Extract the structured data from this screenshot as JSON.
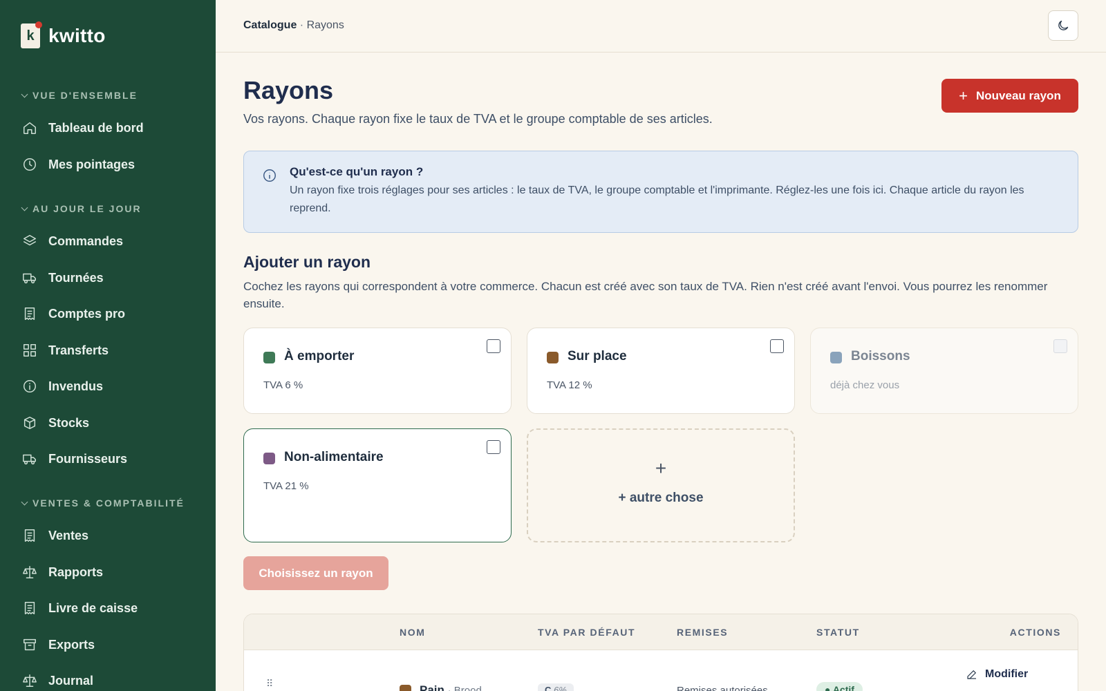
{
  "brand": {
    "name": "kwitto",
    "mark": "k"
  },
  "sidebar": {
    "sections": [
      {
        "label": "VUE D'ENSEMBLE"
      },
      {
        "label": "AU JOUR LE JOUR"
      },
      {
        "label": "VENTES & COMPTABILITÉ"
      }
    ],
    "items": [
      {
        "label": "Tableau de bord",
        "icon": "home-icon"
      },
      {
        "label": "Mes pointages",
        "icon": "clock-icon"
      },
      {
        "label": "Commandes",
        "icon": "layers-icon"
      },
      {
        "label": "Tournées",
        "icon": "truck-icon"
      },
      {
        "label": "Comptes pro",
        "icon": "receipt-icon"
      },
      {
        "label": "Transferts",
        "icon": "grid-icon"
      },
      {
        "label": "Invendus",
        "icon": "info-circle-icon"
      },
      {
        "label": "Stocks",
        "icon": "box-icon"
      },
      {
        "label": "Fournisseurs",
        "icon": "truck-icon"
      },
      {
        "label": "Ventes",
        "icon": "receipt-icon"
      },
      {
        "label": "Rapports",
        "icon": "scale-icon"
      },
      {
        "label": "Livre de caisse",
        "icon": "receipt-icon"
      },
      {
        "label": "Exports",
        "icon": "archive-icon"
      },
      {
        "label": "Journal",
        "icon": "scale-icon"
      }
    ]
  },
  "breadcrumb": {
    "root": "Catalogue",
    "sep": "·",
    "current": "Rayons"
  },
  "page": {
    "title": "Rayons",
    "subtitle": "Vos rayons. Chaque rayon fixe le taux de TVA et le groupe comptable de ses articles.",
    "new_button": "Nouveau rayon"
  },
  "info": {
    "title": "Qu'est-ce qu'un rayon ?",
    "body": "Un rayon fixe trois réglages pour ses articles : le taux de TVA, le groupe comptable et l'imprimante. Réglez-les une fois ici. Chaque article du rayon les reprend."
  },
  "add_section": {
    "title": "Ajouter un rayon",
    "subtitle": "Cochez les rayons qui correspondent à votre commerce. Chacun est créé avec son taux de TVA. Rien n'est créé avant l'envoi. Vous pourrez les renommer ensuite.",
    "cards": [
      {
        "name": "À emporter",
        "sub": "TVA 6 %",
        "color": "#3f7a57"
      },
      {
        "name": "Sur place",
        "sub": "TVA 12 %",
        "color": "#8a5a2b"
      },
      {
        "name": "Boissons",
        "sub": "déjà chez vous",
        "color": "#8aa3bb"
      },
      {
        "name": "Non-alimentaire",
        "sub": "TVA 21 %",
        "color": "#7d5a86"
      }
    ],
    "add_other": {
      "plus": "+",
      "label": "+ autre chose"
    },
    "choose_button": "Choisissez un rayon"
  },
  "table": {
    "headers": [
      "NOM",
      "TVA PAR DÉFAUT",
      "REMISES",
      "STATUT",
      "ACTIONS"
    ],
    "rows": [
      {
        "name": "Pain",
        "alt": "· Brood",
        "tva_code": "C",
        "tva_pct": "6%",
        "remises": "Remises autorisées",
        "status": "● Actif",
        "action": "Modifier",
        "color": "#8a5a2b"
      }
    ]
  }
}
